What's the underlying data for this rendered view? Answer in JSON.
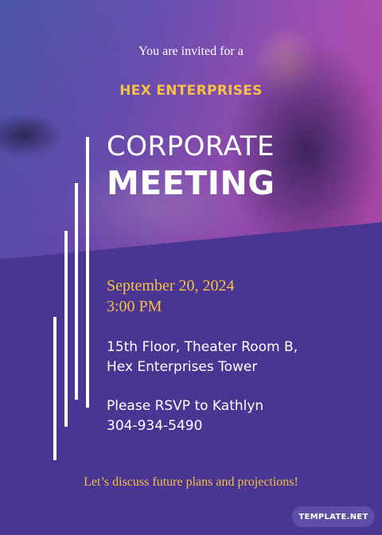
{
  "invitation": {
    "intro": "You are invited for a",
    "company": "HEX ENTERPRISES",
    "title_line1": "CORPORATE",
    "title_line2": "MEETING",
    "date": "September 20, 2024",
    "time": "3:00 PM",
    "location_line1": "15th Floor, Theater Room B,",
    "location_line2": "Hex Enterprises Tower",
    "rsvp_line1": "Please RSVP to Kathlyn",
    "rsvp_line2": "304-934-5490",
    "tagline": "Let’s discuss future plans and projections!"
  },
  "branding": {
    "watermark": "TEMPLATE.NET"
  },
  "colors": {
    "background": "#4a3592",
    "accent": "#f4c144",
    "text": "#ffffff"
  }
}
